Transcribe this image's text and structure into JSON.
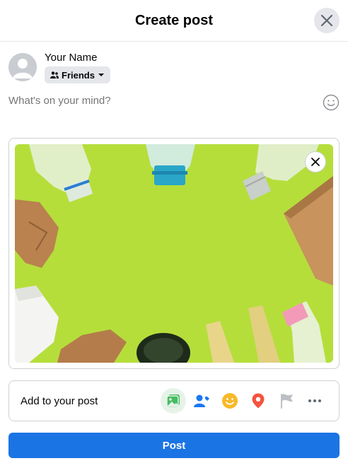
{
  "header": {
    "title": "Create post"
  },
  "author": {
    "name": "Your Name",
    "audience": "Friends"
  },
  "composer": {
    "placeholder": "What's on your mind?",
    "value": ""
  },
  "attachment": {
    "photo_subject": "plastic bottles and paper on green background"
  },
  "add_bar": {
    "label": "Add to your post",
    "icons": [
      "photo-video-icon",
      "tag-people-icon",
      "feeling-icon",
      "check-in-icon",
      "life-event-icon",
      "more-icon"
    ]
  },
  "actions": {
    "post_label": "Post"
  },
  "colors": {
    "accent": "#1b74e4",
    "photo_bg": "#b6df3e",
    "check_in": "#f5533d",
    "feeling": "#f7b928",
    "tag": "#1877f2",
    "photo_icon": "#45bd62"
  }
}
